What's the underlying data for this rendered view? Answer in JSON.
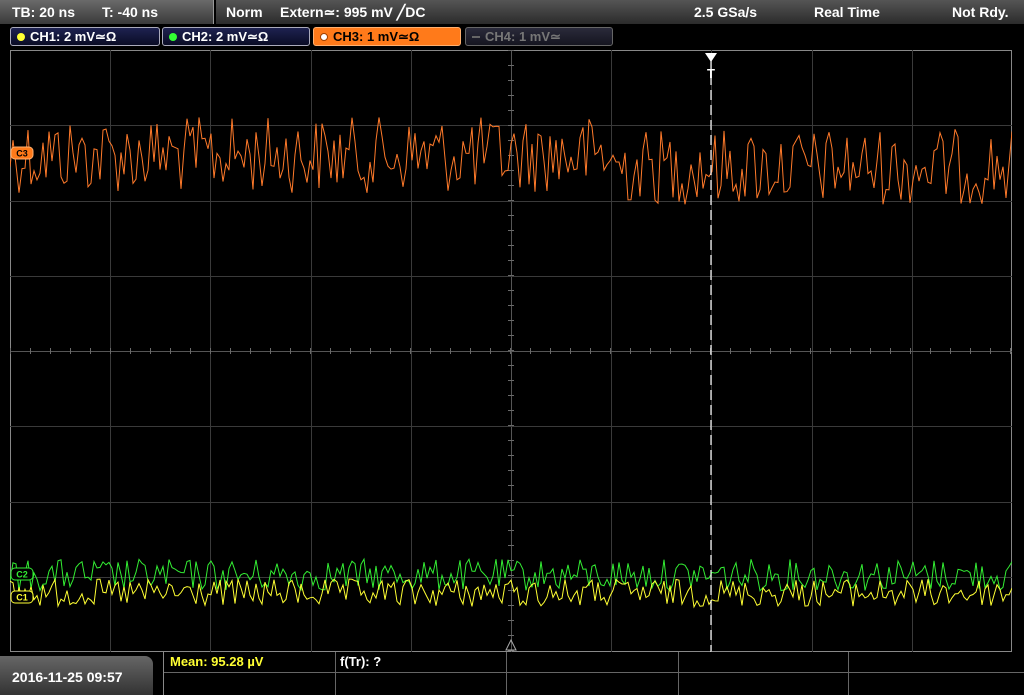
{
  "header": {
    "timebase": "TB: 20 ns",
    "trigger_time": "T: -40 ns",
    "acq_mode": "Norm",
    "trigger_source": "Extern≃: 995 mV ╱DC",
    "sample_rate": "2.5 GSa/s",
    "acq_type": "Real Time",
    "status": "Not Rdy."
  },
  "channels": [
    {
      "label": "CH1: 2 mV≃Ω",
      "color": "#ffff33",
      "state": "on"
    },
    {
      "label": "CH2: 2 mV≃Ω",
      "color": "#33ff33",
      "state": "on"
    },
    {
      "label": "CH3: 1 mV≃Ω",
      "color": "#ff7a1a",
      "state": "selected"
    },
    {
      "label": "CH4: 1 mV≃",
      "color": "#666666",
      "state": "off"
    }
  ],
  "markers": {
    "trigger": "T",
    "ch3": "C3",
    "ch2": "C2",
    "ch1": "C1"
  },
  "measurements": {
    "mean": "Mean: 95.28 µV",
    "ftr": "f(Tr): ?"
  },
  "datetime": "2016-11-25 09:57"
}
